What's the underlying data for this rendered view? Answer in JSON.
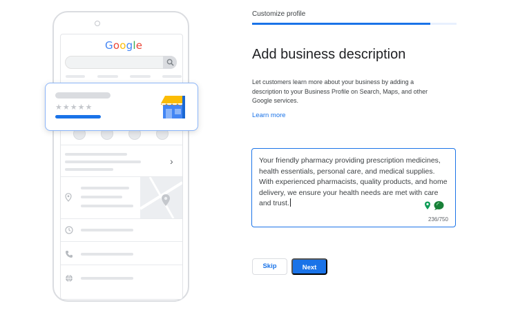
{
  "illustration": {
    "logo_letters": [
      {
        "char": "G",
        "color": "#4285F4"
      },
      {
        "char": "o",
        "color": "#EA4335"
      },
      {
        "char": "o",
        "color": "#FBBC05"
      },
      {
        "char": "g",
        "color": "#4285F4"
      },
      {
        "char": "l",
        "color": "#34A853"
      },
      {
        "char": "e",
        "color": "#EA4335"
      }
    ],
    "stars": "★★★★★",
    "icons": [
      "search-icon",
      "phone-icon",
      "directions-icon",
      "save-icon",
      "share-icon",
      "chevron-right-icon",
      "location-pin-icon",
      "clock-icon",
      "phone-icon",
      "globe-icon",
      "storefront-icon"
    ]
  },
  "header": {
    "breadcrumb": "Customize profile",
    "progress": 0.87
  },
  "main": {
    "title": "Add business description",
    "description": "Let customers learn more about your business by adding a description to your Business Profile on Search, Maps, and other Google services.",
    "learn_more": "Learn more"
  },
  "editor": {
    "value": "Your friendly pharmacy providing prescription medicines, health essentials, personal care, and medical supplies. With experienced pharmacists, quality products, and home delivery, we ensure your health needs are met with care and trust.",
    "counter": "236/750"
  },
  "actions": {
    "skip_label": "Skip",
    "next_label": "Next"
  },
  "colors": {
    "accent": "#1a73e8",
    "progress_track": "#e8f0fe",
    "card_border": "#8ab4f8"
  }
}
